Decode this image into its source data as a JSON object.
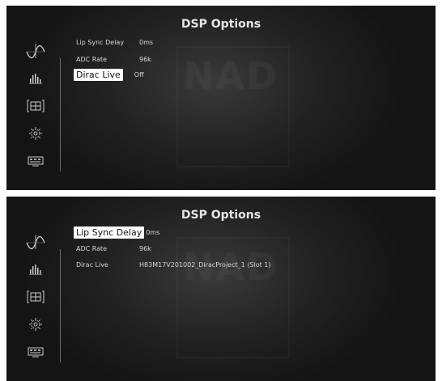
{
  "watermark": "NAD",
  "panels": [
    {
      "title": "DSP Options",
      "rows": [
        {
          "label": "Lip Sync Delay",
          "value": "0ms",
          "selected": false
        },
        {
          "label": "ADC Rate",
          "value": "96k",
          "selected": false
        },
        {
          "label": "Dirac Live",
          "value": "Off",
          "selected": true
        }
      ]
    },
    {
      "title": "DSP Options",
      "rows": [
        {
          "label": "Lip Sync Delay",
          "value": "0ms",
          "selected": true
        },
        {
          "label": "ADC Rate",
          "value": "96k",
          "selected": false
        },
        {
          "label": "Dirac Live",
          "value": "H83M17V201002_DiracProject_1 (Slot 1)",
          "selected": false
        }
      ]
    }
  ],
  "sidebar_icons": [
    "waveform-icon",
    "equalizer-icon",
    "speaker-config-icon",
    "settings-gear-icon",
    "display-icon"
  ],
  "colors": {
    "selection_bg": "#ffffff",
    "text": "#d8d8d8",
    "background": "#1e1e1e"
  }
}
